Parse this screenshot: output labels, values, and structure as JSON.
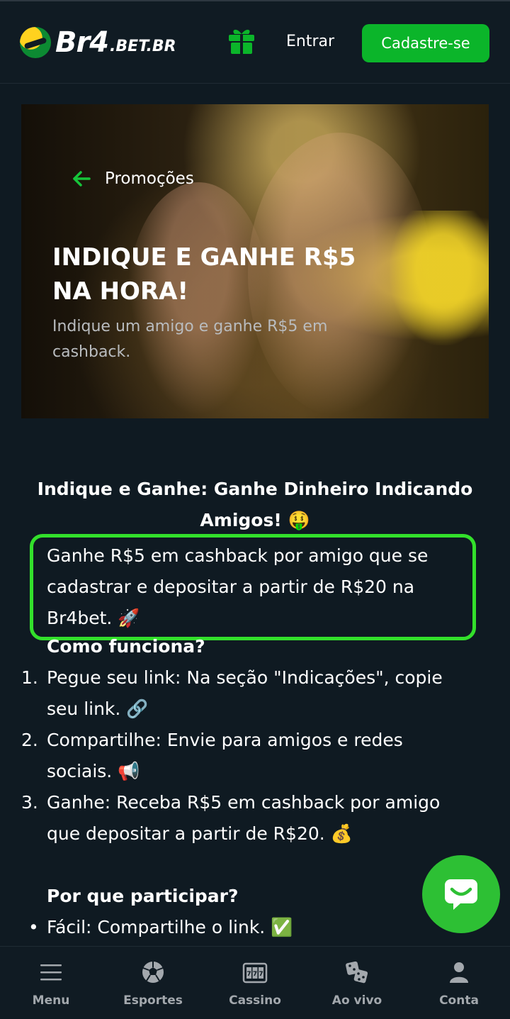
{
  "header": {
    "logo_text": "Br4",
    "logo_suffix": ".BET.BR",
    "gift_icon": "gift-icon",
    "login_label": "Entrar",
    "register_label": "Cadastre-se",
    "accent_color": "#0bb52a"
  },
  "hero": {
    "back_label": "Promoções",
    "back_icon": "arrow-left-icon",
    "title_line1": "INDIQUE E GANHE R$5",
    "title_line2": "NA HORA!",
    "subtitle": "Indique um amigo e ganhe R$5 em cashback."
  },
  "content": {
    "title": "Indique e Ganhe: Ganhe Dinheiro Indicando Amigos! 🤑",
    "intro": "Ganhe R$5 em cashback por amigo que se cadastrar e depositar a partir de R$20 na Br4bet. 🚀",
    "how_title": "Como funciona?",
    "steps": [
      {
        "num": "1.",
        "text": "Pegue seu link: Na seção \"Indicações\", copie seu link. 🔗"
      },
      {
        "num": "2.",
        "text": "Compartilhe: Envie para amigos e redes sociais. 📢"
      },
      {
        "num": "3.",
        "text": "Ganhe: Receba R$5 em cashback por amigo que depositar a partir de R$20. 💰"
      }
    ],
    "why_title": "Por que participar?",
    "bullets": [
      {
        "dot": "•",
        "text": "Fácil: Compartilhe o link. ✅"
      }
    ],
    "highlight_color": "#33e02b"
  },
  "chat": {
    "icon": "chat-bubble-icon"
  },
  "bottom_nav": {
    "items": [
      {
        "label": "Menu",
        "icon": "hamburger-menu-icon"
      },
      {
        "label": "Esportes",
        "icon": "soccer-ball-icon"
      },
      {
        "label": "Cassino",
        "icon": "slot-machine-icon"
      },
      {
        "label": "Ao vivo",
        "icon": "dice-icon"
      },
      {
        "label": "Conta",
        "icon": "user-icon"
      }
    ]
  }
}
